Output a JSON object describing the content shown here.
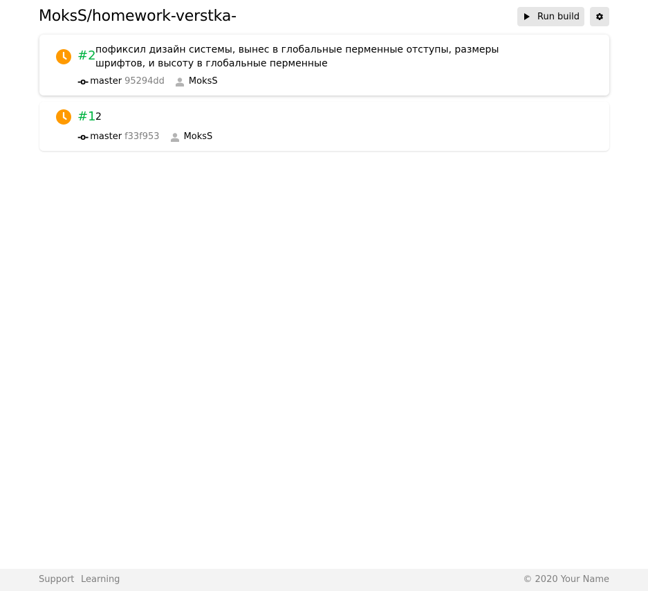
{
  "header": {
    "repo_title": "MoksS/homework-verstka-",
    "run_build_label": "Run build",
    "icons": {
      "run": "play-icon",
      "settings": "gear-icon"
    }
  },
  "builds": [
    {
      "number": "#2",
      "message": "пофиксил дизайн системы, вынес в глобальные перменные отступы, размеры шрифтов, и высоту в глобальные перменные",
      "branch_icon": "-o-",
      "branch": "master",
      "commit": "95294dd",
      "author": "MoksS",
      "status_icon": "clock-icon",
      "status_color": "#ff9a00"
    },
    {
      "number": "#1",
      "message": "2",
      "branch_icon": "-o-",
      "branch": "master",
      "commit": "f33f953",
      "author": "MoksS",
      "status_icon": "clock-icon",
      "status_color": "#ff9a00"
    }
  ],
  "footer": {
    "links": [
      "Support",
      "Learning"
    ],
    "copyright": "© 2020 Your Name"
  },
  "colors": {
    "accent_green": "#00b341",
    "pending_orange": "#ff9a00",
    "muted_text": "#7f7f7f",
    "button_bg": "#e6e6e6",
    "footer_bg": "#f3f3f3"
  }
}
